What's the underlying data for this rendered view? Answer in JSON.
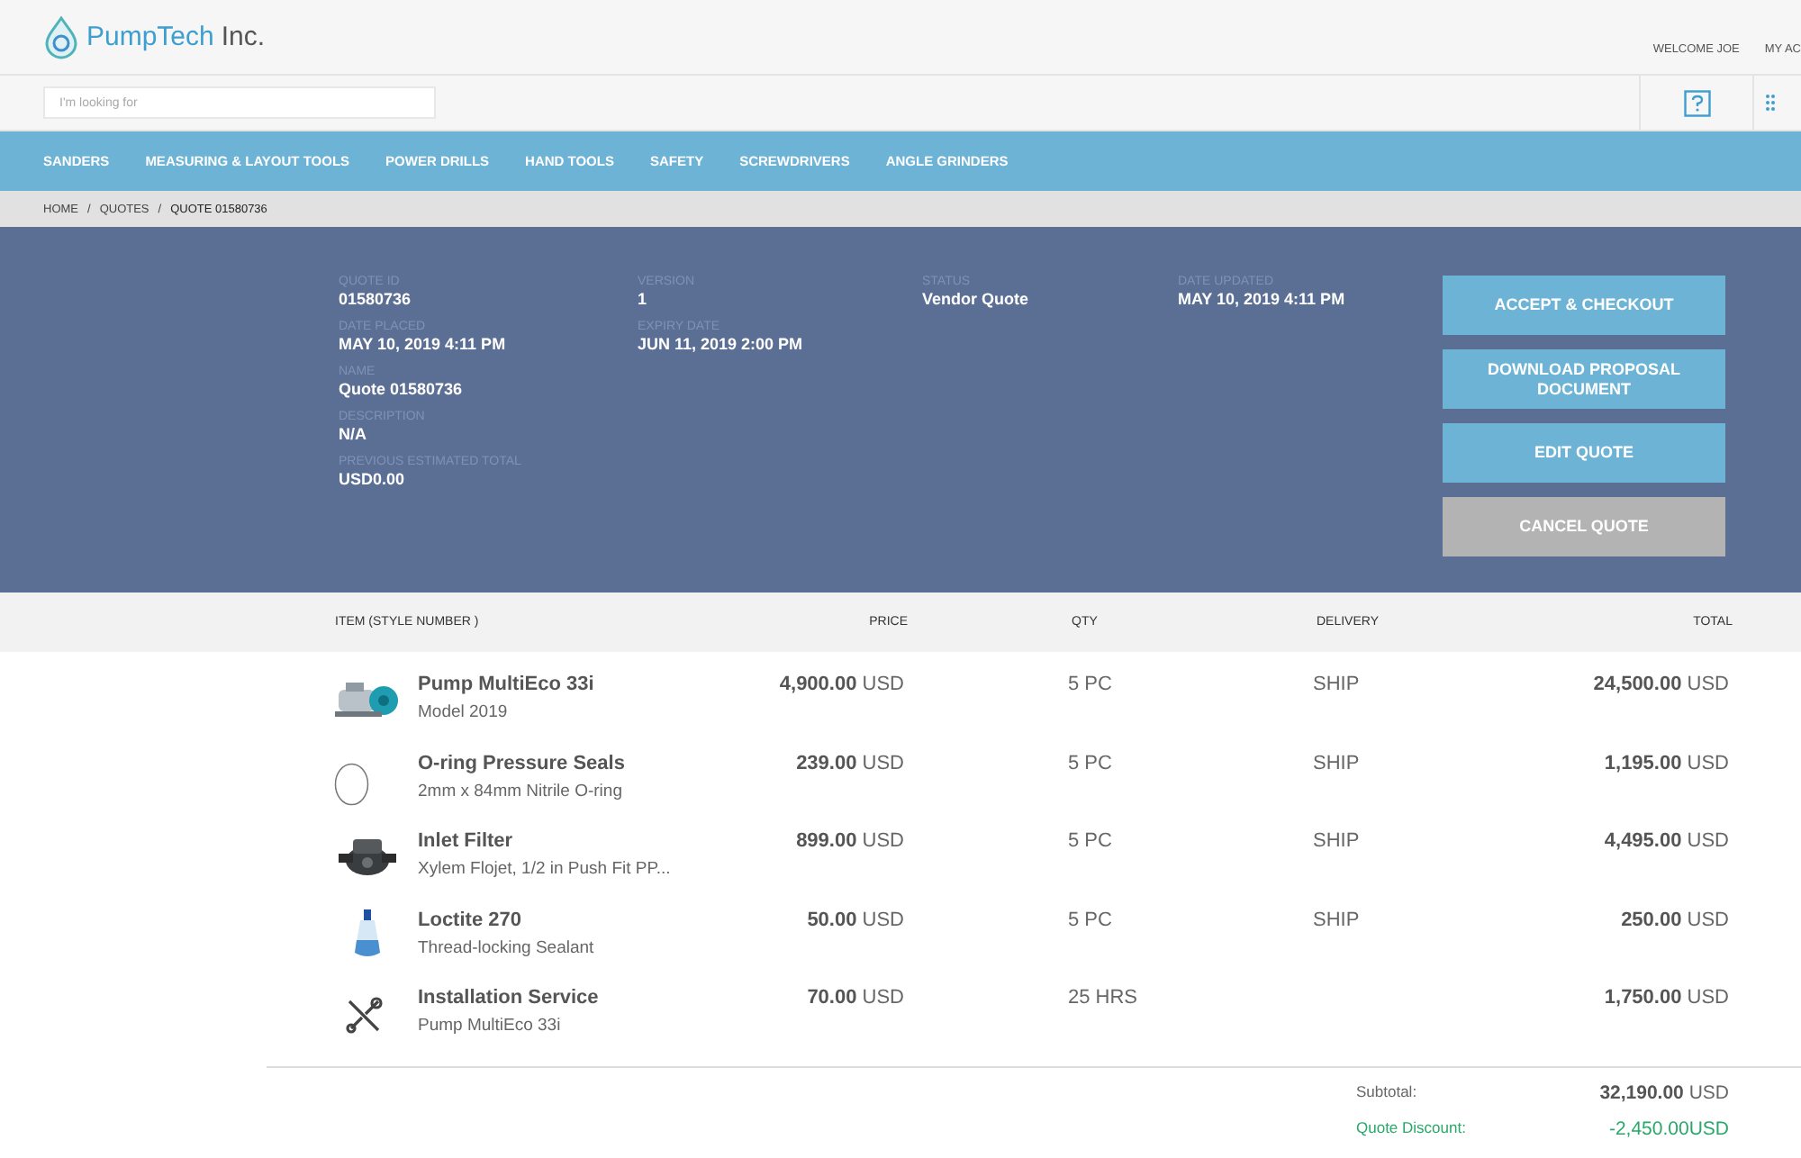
{
  "header": {
    "brand": "PumpTech",
    "brand_suffix": "Inc.",
    "welcome": "WELCOME JOE",
    "account": "MY AC"
  },
  "search": {
    "placeholder": "I'm looking for"
  },
  "nav": [
    "SANDERS",
    "MEASURING & LAYOUT TOOLS",
    "POWER DRILLS",
    "HAND TOOLS",
    "SAFETY",
    "SCREWDRIVERS",
    "ANGLE GRINDERS"
  ],
  "breadcrumb": [
    "HOME",
    "QUOTES",
    "QUOTE 01580736"
  ],
  "breadcrumb_separator": "/",
  "summary": {
    "columns": [
      [
        {
          "label": "QUOTE ID",
          "value": "01580736"
        },
        {
          "label": "DATE PLACED",
          "value": "MAY 10, 2019 4:11 PM"
        },
        {
          "label": "NAME",
          "value": "Quote 01580736"
        },
        {
          "label": "DESCRIPTION",
          "value": "N/A"
        },
        {
          "label": "PREVIOUS ESTIMATED TOTAL",
          "value": "USD0.00"
        }
      ],
      [
        {
          "label": "VERSION",
          "value": "1"
        },
        {
          "label": "EXPIRY DATE",
          "value": "JUN 11, 2019 2:00 PM"
        }
      ],
      [
        {
          "label": "STATUS",
          "value": "Vendor Quote"
        }
      ],
      [
        {
          "label": "DATE UPDATED",
          "value": "MAY 10, 2019 4:11 PM"
        }
      ]
    ],
    "actions": [
      {
        "label": "ACCEPT & CHECKOUT",
        "disabled": false
      },
      {
        "label": "DOWNLOAD PROPOSAL DOCUMENT",
        "disabled": false
      },
      {
        "label": "EDIT QUOTE",
        "disabled": false
      },
      {
        "label": "CANCEL QUOTE",
        "disabled": true
      }
    ]
  },
  "table": {
    "columns": [
      "ITEM (STYLE NUMBER )",
      "PRICE",
      "QTY",
      "DELIVERY",
      "TOTAL"
    ],
    "rows": [
      {
        "kind": "product",
        "name": "Pump MultiEco 33i",
        "detail": "Model 2019",
        "price": "**4,900.00** USD",
        "qty": "5 PC",
        "delivery": "SHIP",
        "total": "**24,500.00** USD"
      },
      {
        "kind": "ring",
        "name": "O-ring Pressure Seals",
        "detail": "2mm x 84mm Nitrile O-ring",
        "price": "**239.00** USD",
        "qty": "5 PC",
        "delivery": "SHIP",
        "total": "**1,195.00** USD"
      },
      {
        "kind": "product",
        "name": "Inlet Filter",
        "detail": "Xylem Flojet, 1/2 in Push Fit PP...",
        "price": "**899.00** USD",
        "qty": "5 PC",
        "delivery": "SHIP",
        "total": "**4,495.00** USD"
      },
      {
        "kind": "product",
        "name": "Loctite 270",
        "detail": "Thread-locking Sealant",
        "price": "**50.00** USD",
        "qty": "5 PC",
        "delivery": "SHIP",
        "total": "**250.00** USD"
      },
      {
        "kind": "service",
        "name": "Installation Service",
        "detail": "Pump MultiEco 33i",
        "price": "**70.00** USD",
        "qty": "25 HRS",
        "total": "**1,750.00** USD"
      }
    ]
  },
  "totals": [
    {
      "kind": "plain",
      "label": "Subtotal:",
      "value": "**32,190.00** USD"
    },
    {
      "kind": "discount",
      "label": "Quote Discount:",
      "value": "-2,450.00USD"
    }
  ]
}
